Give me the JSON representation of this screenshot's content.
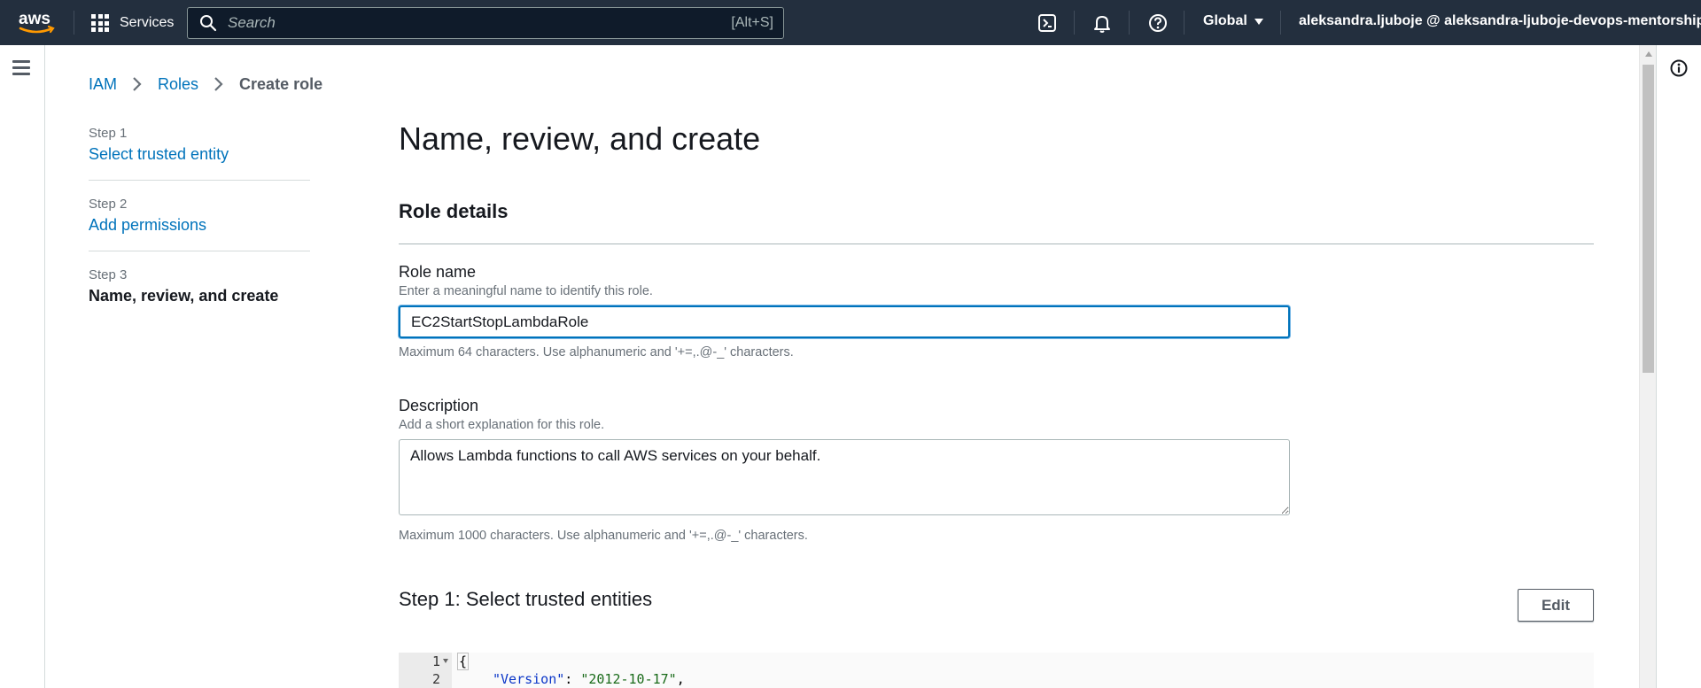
{
  "topnav": {
    "services_label": "Services",
    "search_placeholder": "Search",
    "search_shortcut": "[Alt+S]",
    "region_label": "Global",
    "account_label": "aleksandra.ljuboje @ aleksandra-ljuboje-devops-mentorship",
    "icons": [
      "aws-logo",
      "grid-icon",
      "search-icon",
      "cloudshell-icon",
      "bell-icon",
      "help-icon"
    ]
  },
  "breadcrumb": {
    "items": [
      "IAM",
      "Roles"
    ],
    "current": "Create role"
  },
  "wizard": {
    "steps": [
      {
        "num": "Step 1",
        "label": "Select trusted entity"
      },
      {
        "num": "Step 2",
        "label": "Add permissions"
      },
      {
        "num": "Step 3",
        "label": "Name, review, and create"
      }
    ]
  },
  "main": {
    "page_title": "Name, review, and create",
    "section_title": "Role details",
    "role_name": {
      "label": "Role name",
      "description": "Enter a meaningful name to identify this role.",
      "value": "EC2StartStopLambdaRole",
      "constraint": "Maximum 64 characters. Use alphanumeric and '+=,.@-_' characters."
    },
    "description_field": {
      "label": "Description",
      "description": "Add a short explanation for this role.",
      "value": "Allows Lambda functions to call AWS services on your behalf.",
      "constraint": "Maximum 1000 characters. Use alphanumeric and '+=,.@-_' characters."
    },
    "step1_heading": "Step 1: Select trusted entities",
    "edit_label": "Edit",
    "code": {
      "line1_num": "1",
      "line1_text": "{",
      "line2_num": "2",
      "line2_key": "\"Version\"",
      "line2_sep": ": ",
      "line2_value": "\"2012-10-17\"",
      "line2_end": ","
    }
  },
  "colors": {
    "nav_bg": "#232f3e",
    "link": "#0073bb",
    "focus_border": "#0073bb"
  }
}
